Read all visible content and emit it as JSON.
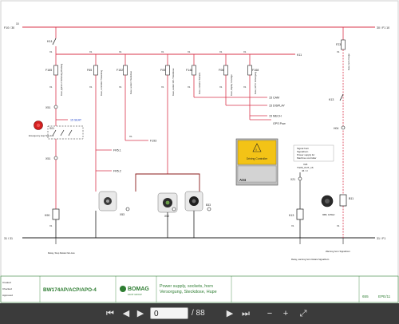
{
  "rails": {
    "top_left": "F10 / 30",
    "top_left_sig": "15",
    "top_right": "30 / F1 10",
    "bottom_left": "31 / 31",
    "bottom_right": "31 / F1"
  },
  "devices": {
    "k11": "K11",
    "f165": "F165",
    "f65": "F65",
    "f152": "F152",
    "f05": "F05",
    "f148": "F148",
    "f06": "F06",
    "f168": "F168",
    "f23": "F23",
    "s01": "S01",
    "x51": "X51",
    "x51b": "X51",
    "k90": "K90",
    "k13": "K13",
    "k13b": "K13",
    "k33": "K33",
    "x53": "X53",
    "x52": "X52",
    "b33": "B33",
    "x21": "X21",
    "h04": "H04",
    "b11": "B11",
    "a34": "A34"
  },
  "signals": {
    "seat": "15 SEAT",
    "fr51": "FR5.1",
    "fr52": "FR5.2",
    "f193": "F193",
    "cam": "15 CAM",
    "display": "15 DISPLAY",
    "mech": "15 MECH",
    "gps": "GPS Pow"
  },
  "labels": {
    "emergency_stop": "Emergency stop Not-Aus",
    "relay_stop": "Relay, Stop Relais Not-Aus",
    "relay_horn": "Relay, warning horn Relais Signalhorn",
    "warning_horn": "Warning horn Signalhorn",
    "horn_spec": "96B, 105Hz",
    "driving_controller": "Driving Controller",
    "a34_notes": [
      "Signal horn",
      "Signalhorn",
      "Power supply for",
      "Machine controller",
      "X26",
      "TG06_OUT_16",
      "46 / 3"
    ]
  },
  "title_block": {
    "created_label": "Created",
    "checked_label": "Checked",
    "approved_label": "Approved",
    "model": "BW174AP/ACP/APO-4",
    "brand": "BOMAG",
    "brand_sub": "FAYAT GROUP",
    "title_en": "Power supply, sockets, horn",
    "title_de": "Versorgung, Steckdose, Hupe",
    "sheet_no": "655",
    "drawing_no": "EPE/11"
  },
  "viewer": {
    "page_current": "0",
    "page_total": "/ 88"
  },
  "colors": {
    "wire": "#d9344b",
    "wire_dark": "#1f1f1f",
    "signal": "#2244cc",
    "plc_yellow": "#f3c316",
    "plc_gray": "#bdbdbd",
    "estop_red": "#d42020",
    "titleblock": "#2e7d32"
  }
}
